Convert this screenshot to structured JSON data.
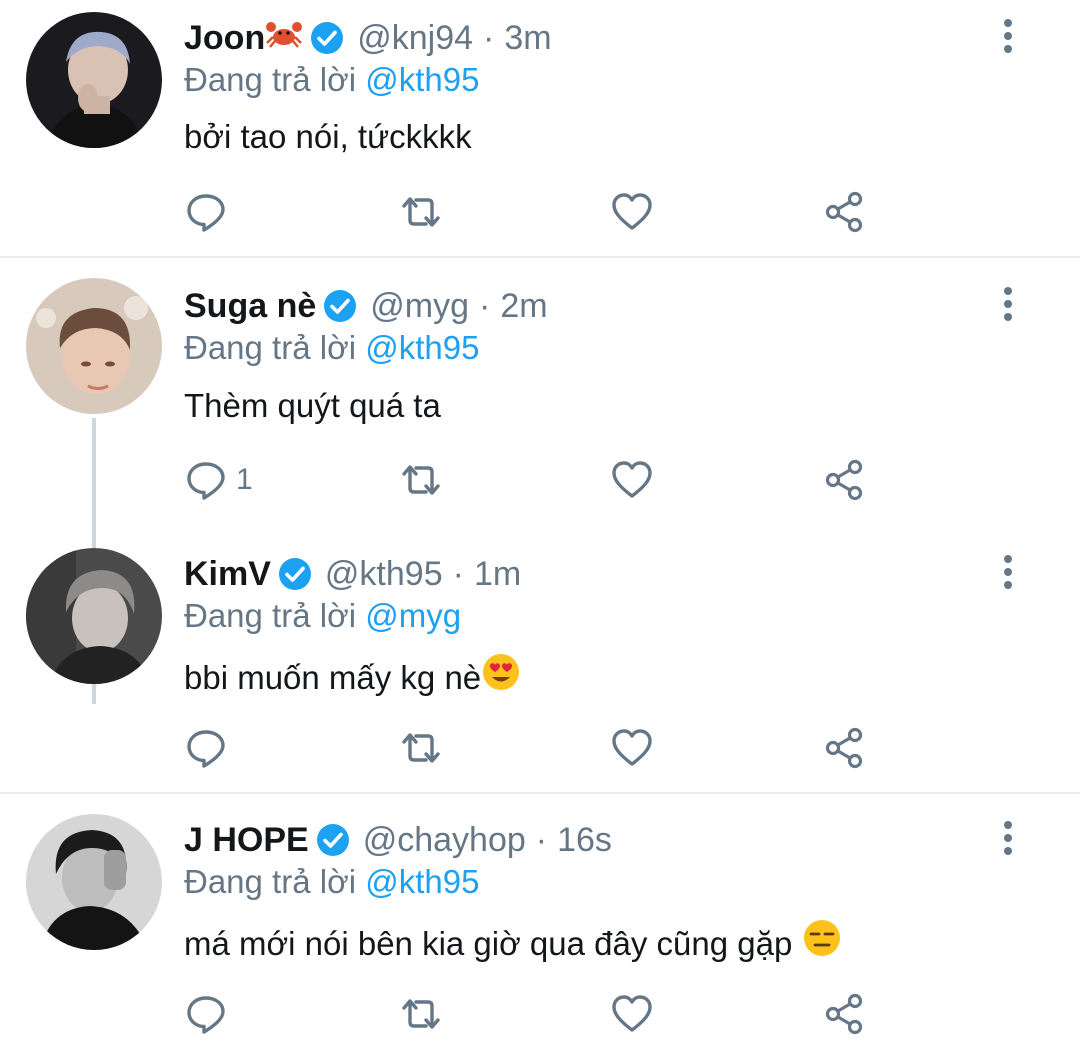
{
  "reply_prefix": "Đang trả lời",
  "colors": {
    "link": "#1da1f2",
    "secondary": "#657786",
    "verified": "#1da1f2",
    "divider": "#e6ecf0"
  },
  "tweets": [
    {
      "name": "Joon",
      "name_emoji": "crab-emoji",
      "handle": "@knj94",
      "separator": "·",
      "time": "3m",
      "reply_to": "@kth95",
      "text": "bởi tao nói, tứckkkk",
      "reply_count": ""
    },
    {
      "name": "Suga nè",
      "handle": "@myg",
      "separator": "·",
      "time": "2m",
      "reply_to": "@kth95",
      "text": "Thèm quýt quá ta",
      "reply_count": "1"
    },
    {
      "name": "KimV",
      "handle": "@kth95",
      "separator": "·",
      "time": "1m",
      "reply_to": "@myg",
      "text": "bbi muốn mấy kg nè",
      "text_emoji": "heart-eyes-emoji",
      "reply_count": ""
    },
    {
      "name": "J HOPE",
      "handle": "@chayhop",
      "separator": "·",
      "time": "16s",
      "reply_to": "@kth95",
      "text": "má mới nói bên kia giờ qua đây cũng gặp",
      "text_emoji": "expressionless-emoji",
      "reply_count": ""
    }
  ],
  "icons": {
    "reply": "reply-icon",
    "retweet": "retweet-icon",
    "like": "heart-icon",
    "share": "share-icon",
    "more": "more-vertical-icon",
    "verified": "verified-badge-icon"
  }
}
